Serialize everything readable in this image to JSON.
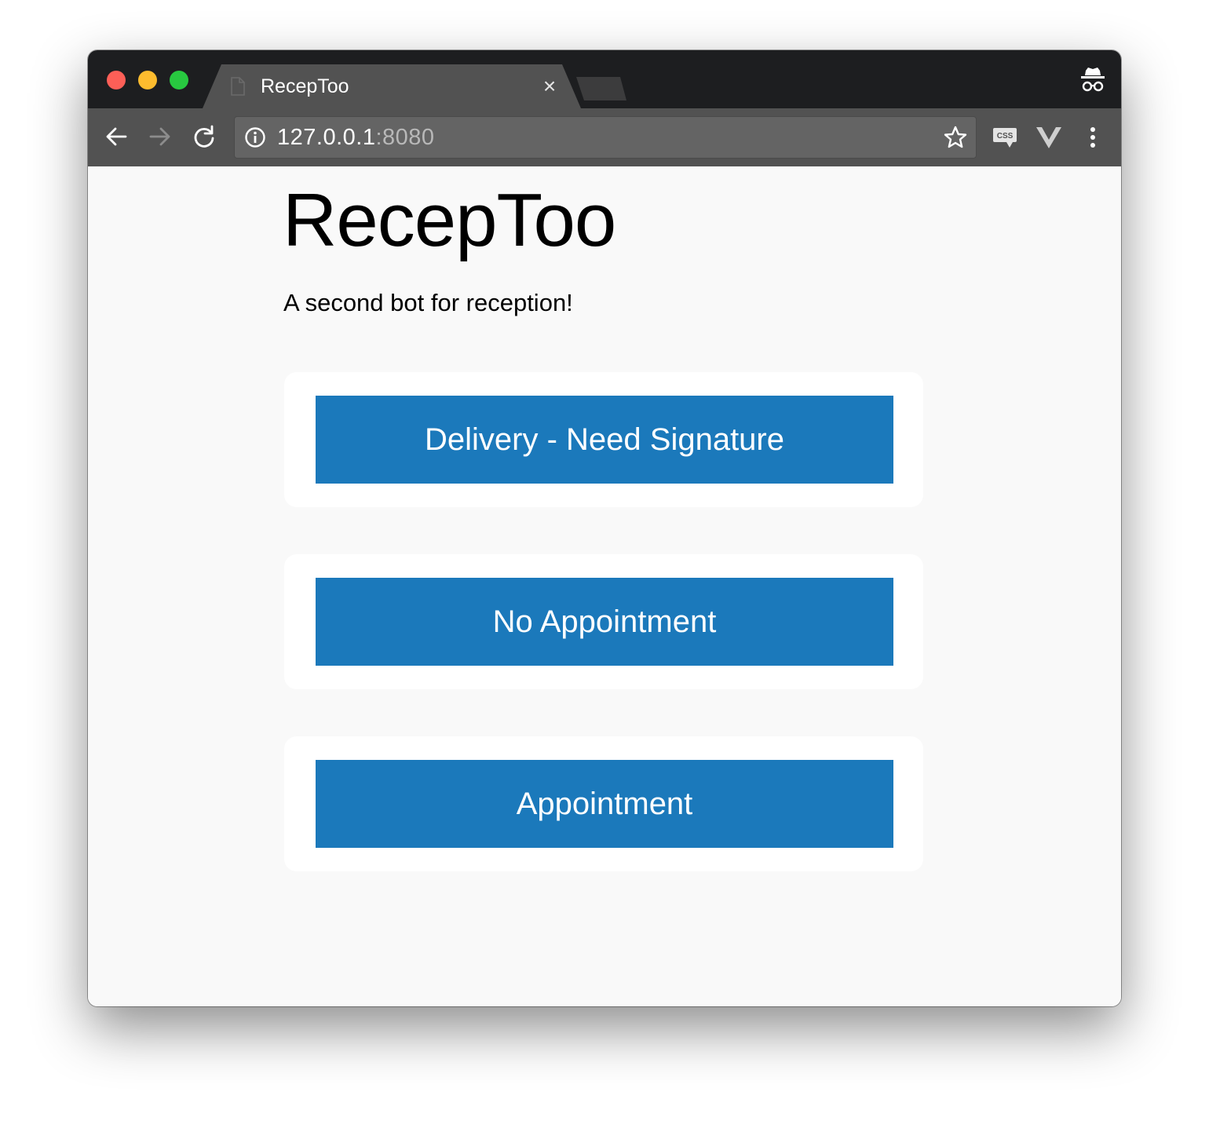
{
  "browser": {
    "tab": {
      "title": "RecepToo",
      "close_symbol": "×",
      "favicon_icon": "document-icon"
    },
    "omnibox": {
      "host": "127.0.0.1",
      "port": ":8080",
      "info_icon": "info-icon",
      "bookmark_icon": "star-icon"
    },
    "controls": {
      "back_icon": "arrow-left-icon",
      "forward_icon": "arrow-right-icon",
      "reload_icon": "reload-icon",
      "incognito_icon": "incognito-icon",
      "css_extension_icon": "css-extension-icon",
      "vue_extension_icon": "vue-devtools-icon",
      "menu_icon": "more-vertical-icon"
    },
    "traffic_lights": {
      "close_color": "#fd5f57",
      "minimize_color": "#fdbc2e",
      "zoom_color": "#28c940"
    }
  },
  "page": {
    "title": "RecepToo",
    "subtitle": "A second bot for reception!",
    "accent_color": "#1b79bb",
    "buttons": [
      {
        "label": "Delivery - Need Signature"
      },
      {
        "label": "No Appointment"
      },
      {
        "label": "Appointment"
      }
    ]
  }
}
